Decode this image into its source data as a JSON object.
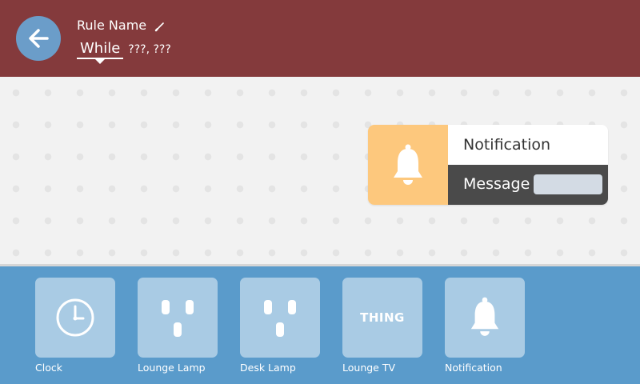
{
  "header": {
    "rule_name": "Rule Name",
    "while_label": "While",
    "while_rest": "???, ???",
    "background_color": "#843a3c",
    "back_icon": "arrow-left-icon",
    "edit_icon": "pencil-icon"
  },
  "canvas": {
    "notification_block": {
      "icon": "bell-icon",
      "title": "Notification",
      "message_label": "Message",
      "message_value": "",
      "icon_color": "#fdc87d"
    }
  },
  "palette": {
    "background_color": "#5a9bcb",
    "items": [
      {
        "label": "Clock",
        "icon": "clock-icon"
      },
      {
        "label": "Lounge Lamp",
        "icon": "outlet-icon"
      },
      {
        "label": "Desk Lamp",
        "icon": "outlet-icon"
      },
      {
        "label": "Lounge TV",
        "icon_text": "THING"
      },
      {
        "label": "Notification",
        "icon": "bell-icon"
      }
    ]
  }
}
